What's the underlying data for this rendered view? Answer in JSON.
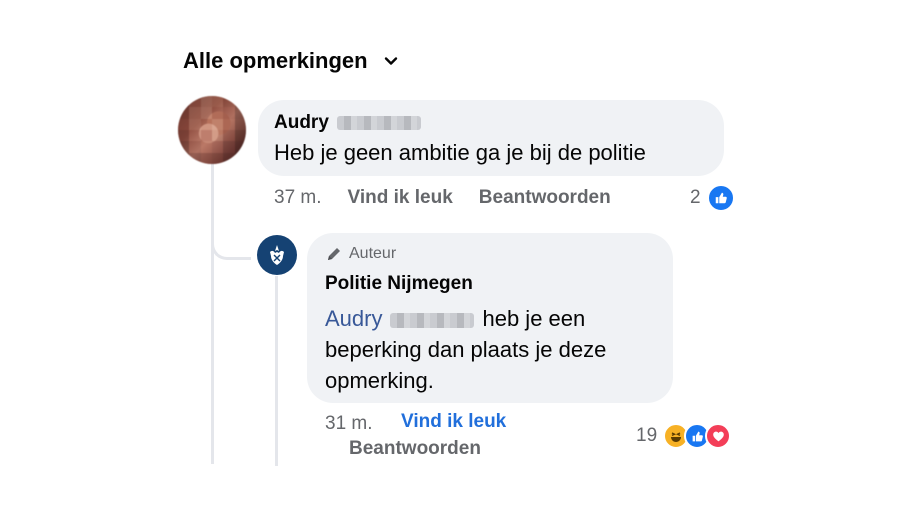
{
  "header": {
    "title": "Alle opmerkingen"
  },
  "comment1": {
    "author_first": "Audry",
    "text": "Heb je geen ambitie ga je bij de politie",
    "time": "37 m.",
    "like_label": "Vind ik leuk",
    "reply_label": "Beantwoorden",
    "reaction_count": "2",
    "reactions": [
      "like-icon"
    ]
  },
  "reply1": {
    "badge": "Auteur",
    "author": "Politie Nijmegen",
    "mention": "Audry",
    "text": "heb je een beperking dan plaats je deze opmerking.",
    "time": "31 m.",
    "like_label": "Vind ik leuk",
    "reply_label": "Beantwoorden",
    "reaction_count": "19",
    "reactions": [
      "haha-icon",
      "like-icon",
      "love-icon"
    ]
  },
  "colors": {
    "link": "#385898",
    "liked": "#216fdb",
    "like_blue": "#1877f2",
    "love_red": "#f33e58",
    "haha_yellow": "#f7b125",
    "bubble": "#f0f2f5"
  }
}
